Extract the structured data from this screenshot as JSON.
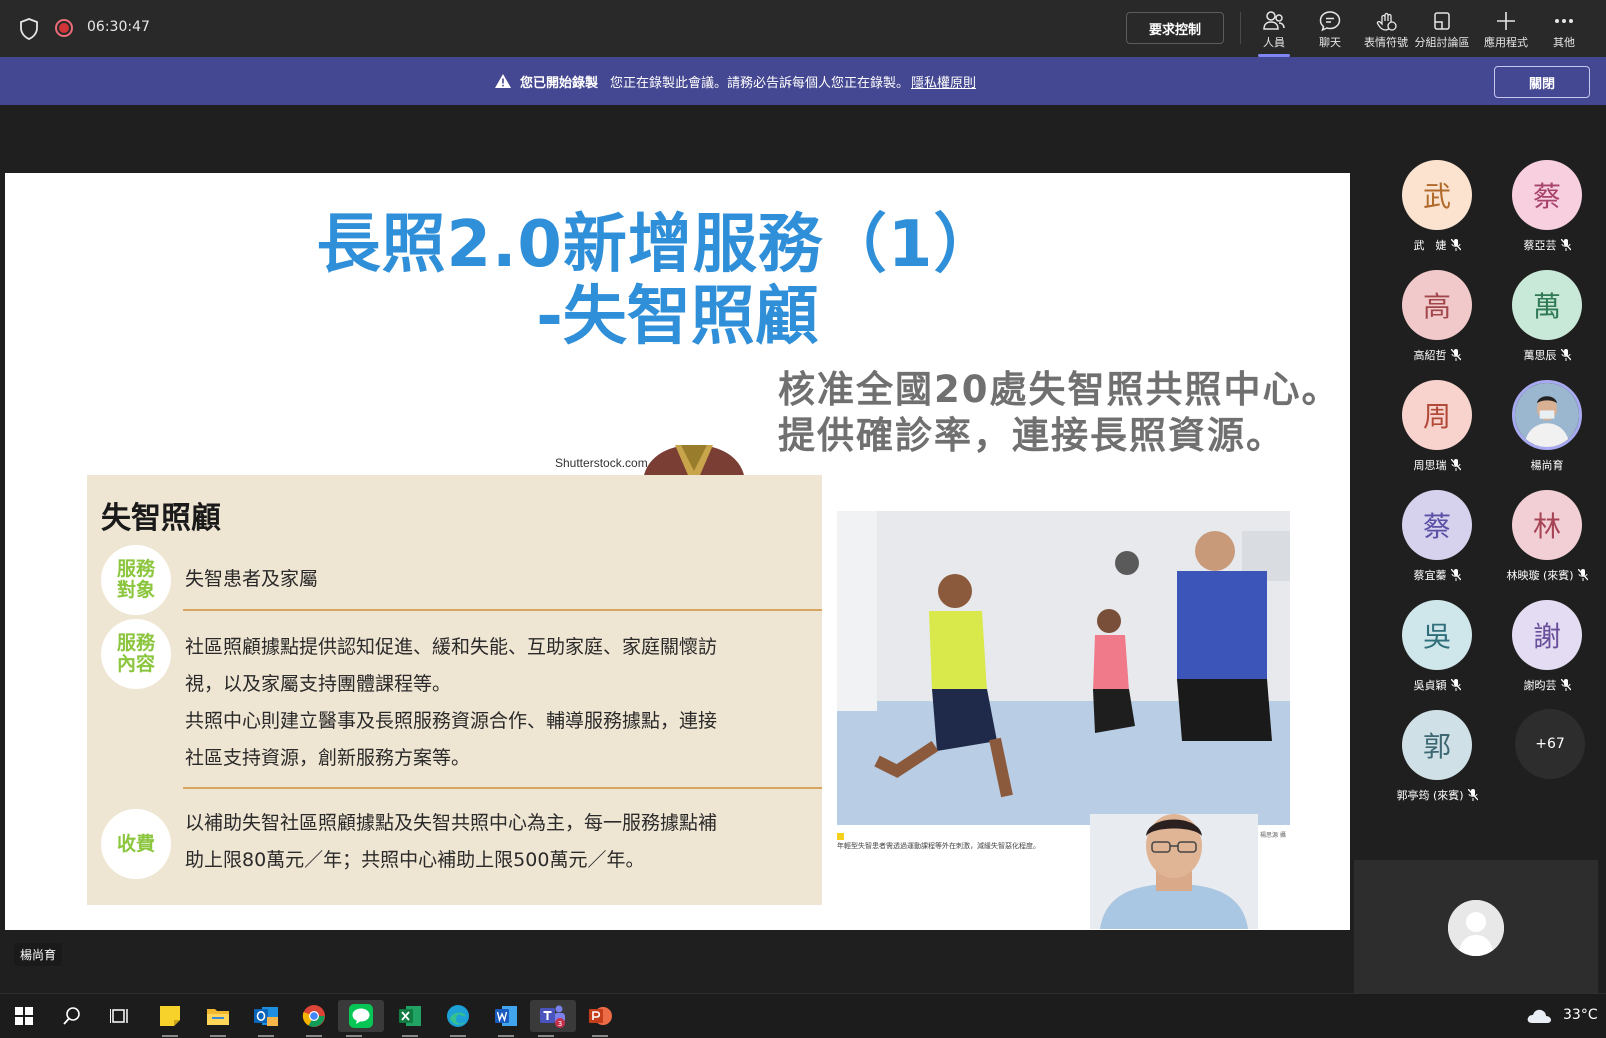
{
  "topbar": {
    "timer": "06:30:47",
    "request_control": "要求控制",
    "buttons": [
      {
        "label": "人員",
        "icon": "people-icon"
      },
      {
        "label": "聊天",
        "icon": "chat-icon"
      },
      {
        "label": "表情符號",
        "icon": "emoji-icon"
      },
      {
        "label": "分組討論區",
        "icon": "breakout-rooms-icon"
      },
      {
        "label": "應用程式",
        "icon": "plus-icon"
      },
      {
        "label": "其他",
        "icon": "more-icon"
      }
    ]
  },
  "banner": {
    "title": "您已開始錄製",
    "message": "您正在錄製此會議。請務必告訴每個人您正在錄製。",
    "link": "隱私權原則",
    "close": "關閉"
  },
  "slide": {
    "title_line1": "長照2.0新增服務（1）",
    "title_line2": "-失智照顧",
    "subtitle_line1": "核准全國20處失智照共照中心。",
    "subtitle_line2": "提供確診率，連接長照資源。",
    "watermark": "Shutterstock.com",
    "card": {
      "title": "失智照顧",
      "rows": [
        {
          "badge": "服務對象",
          "text": [
            "失智患者及家屬"
          ]
        },
        {
          "badge": "服務內容",
          "text": [
            "社區照顧據點提供認知促進、緩和失能、互助家庭、家庭關懷訪",
            "視，以及家屬支持團體課程等。",
            "共照中心則建立醫事及長照服務資源合作、輔導服務據點，連接",
            "社區支持資源，創新服務方案等。"
          ]
        },
        {
          "badge": "收費",
          "text": [
            "以補助失智社區照顧據點及失智共照中心為主，每一服務據點補",
            "助上限80萬元／年；共照中心補助上限500萬元／年。"
          ]
        }
      ]
    },
    "photo_caption": "年輕型失智患者需透過運動課程等外在刺激，減緩失智惡化程度。",
    "photo_credit": "楊思源 攝"
  },
  "presenter_label": "楊尚育",
  "participants": [
    {
      "initial": "武",
      "name": "武　婕",
      "color": "#fbe3cf",
      "muted": true
    },
    {
      "initial": "蔡",
      "name": "蔡亞芸",
      "color": "#f7cfdf",
      "muted": true
    },
    {
      "initial": "高",
      "name": "高紹哲",
      "color": "#f2c9ca",
      "muted": true
    },
    {
      "initial": "萬",
      "name": "萬思辰",
      "color": "#c8e8d8",
      "muted": true
    },
    {
      "initial": "周",
      "name": "周思瑞",
      "color": "#f8d3cd",
      "muted": true
    },
    {
      "initial": "",
      "name": "楊尚育",
      "color": "#8fb6d8",
      "muted": false,
      "photo": true
    },
    {
      "initial": "蔡",
      "name": "蔡宜蓁",
      "color": "#d6d2ee",
      "muted": true
    },
    {
      "initial": "林",
      "name": "林映璇 (來賓)",
      "color": "#f2cfd4",
      "muted": true
    },
    {
      "initial": "吳",
      "name": "吳貞穎",
      "color": "#cfe6ea",
      "muted": true
    },
    {
      "initial": "謝",
      "name": "謝昀芸",
      "color": "#e3dcf2",
      "muted": true
    },
    {
      "initial": "郭",
      "name": "郭亭筠 (來賓)",
      "color": "#cfe1e6",
      "muted": true
    }
  ],
  "more_participants": "+67",
  "taskbar": {
    "apps": [
      "windows-start-icon",
      "search-icon",
      "task-view-icon",
      "sticky-notes-icon",
      "file-explorer-icon",
      "outlook-icon",
      "chrome-icon",
      "line-icon",
      "excel-icon",
      "edge-icon",
      "word-icon",
      "teams-icon",
      "powerpoint-icon"
    ],
    "temperature": "33°C"
  },
  "colors": {
    "banner_bg": "#444791",
    "accent": "#7f85f5",
    "slide_title": "#2f8fd8",
    "badge_green": "#8cc63e",
    "card_bg": "#efe5d3"
  }
}
